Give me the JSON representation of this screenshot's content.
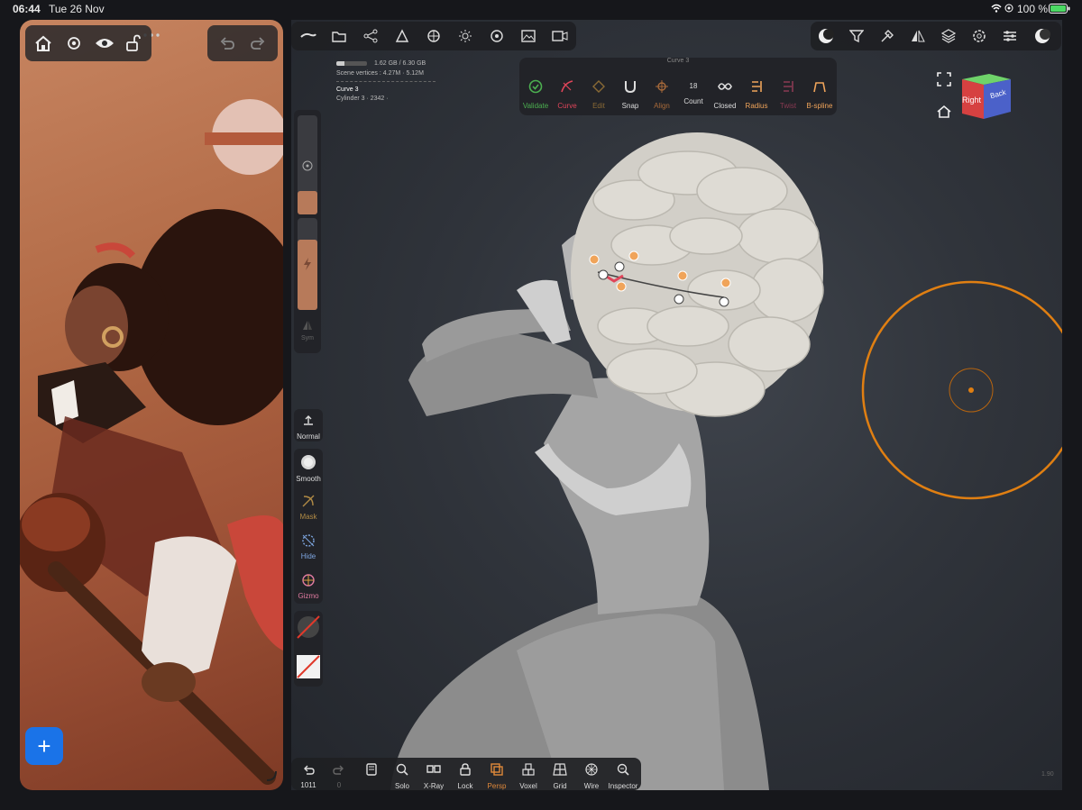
{
  "status_bar": {
    "time": "06:44",
    "date": "Tue 26 Nov",
    "battery": "100 %"
  },
  "reference_window": {
    "toolbar": {
      "icons": [
        "home-icon",
        "settings-icon",
        "eye-icon",
        "unlock-icon"
      ]
    },
    "history": {
      "icons": [
        "undo-icon",
        "redo-icon"
      ]
    },
    "add_button_label": "+"
  },
  "top_toolbar_left": {
    "icons": [
      "menu-icon",
      "folder-icon",
      "scene-graph-icon",
      "paint-icon",
      "material-icon",
      "sun-icon",
      "postprocess-icon",
      "background-icon",
      "video-icon"
    ]
  },
  "top_toolbar_right": {
    "icons": [
      "moon-icon",
      "filter-icon",
      "tools-icon",
      "symmetry-icon",
      "layers-icon",
      "settings-icon",
      "sliders-icon",
      "matcap-icon"
    ]
  },
  "scene_info": {
    "memory": "1.62 GB / 6.30 GB",
    "vertices_label": "Scene vertices :",
    "vertices_value": "4.27M · 5.12M",
    "items": [
      "Curve 3",
      "Cylinder 3 · 2342 · "
    ],
    "memory_fraction": 0.26
  },
  "curve_panel": {
    "title": "Curve 3",
    "tools": [
      {
        "label": "Validate",
        "icon": "check-circle-icon",
        "color": "#4caf50"
      },
      {
        "label": "Curve",
        "icon": "curve-icon",
        "color": "#e0455a"
      },
      {
        "label": "Edit",
        "icon": "edit-points-icon",
        "color": "#8a6a35"
      },
      {
        "label": "Snap",
        "icon": "magnet-icon",
        "color": "#d9d9d9"
      },
      {
        "label": "Align",
        "icon": "align-icon",
        "color": "#a86a3a"
      },
      {
        "label": "Count",
        "icon": "count-icon",
        "value": "18",
        "color": "#d9d9d9"
      },
      {
        "label": "Closed",
        "icon": "infinity-icon",
        "color": "#d9d9d9"
      },
      {
        "label": "Radius",
        "icon": "radius-icon",
        "color": "#f0a45a"
      },
      {
        "label": "Twist",
        "icon": "twist-icon",
        "color": "#8a3a52"
      },
      {
        "label": "B-spline",
        "icon": "bspline-icon",
        "color": "#f0a45a"
      }
    ]
  },
  "view_cube": {
    "right": "Right",
    "back": "Back"
  },
  "left_tools": [
    {
      "label": "Normal",
      "icon": "normal-icon",
      "color": "#d9d9d9"
    },
    {
      "label": "Smooth",
      "icon": "smooth-icon",
      "color": "#d9d9d9"
    },
    {
      "label": "Mask",
      "icon": "mask-icon",
      "color": "#b08a45"
    },
    {
      "label": "Hide",
      "icon": "hide-icon",
      "color": "#7ea6e0"
    },
    {
      "label": "Gizmo",
      "icon": "gizmo-icon",
      "color": "#e07aa0"
    }
  ],
  "sym_label": "Sym",
  "bottom_toolbar": {
    "undo_count": "1011",
    "redo_count": "0",
    "items": [
      {
        "label": "Solo",
        "icon": "solo-icon",
        "color": "#d9d9d9"
      },
      {
        "label": "X-Ray",
        "icon": "xray-icon",
        "color": "#d9d9d9"
      },
      {
        "label": "Lock",
        "icon": "lock-icon",
        "color": "#d9d9d9"
      },
      {
        "label": "Persp",
        "icon": "perspective-icon",
        "color": "#e0893a"
      },
      {
        "label": "Voxel",
        "icon": "voxel-icon",
        "color": "#d9d9d9"
      },
      {
        "label": "Grid",
        "icon": "grid-icon",
        "color": "#d9d9d9"
      },
      {
        "label": "Wire",
        "icon": "wireframe-icon",
        "color": "#d9d9d9"
      },
      {
        "label": "Inspector",
        "icon": "inspector-icon",
        "color": "#d9d9d9"
      }
    ]
  },
  "version": "1.90"
}
